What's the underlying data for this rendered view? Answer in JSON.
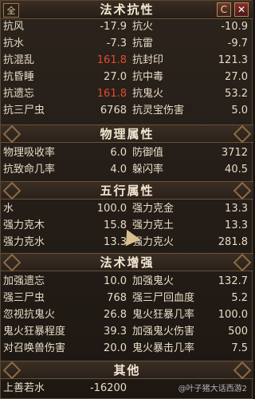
{
  "window": {
    "corner_label": "全",
    "title": "法术抗性",
    "refresh_label": "C",
    "close_label": "✕"
  },
  "sections": {
    "resist": [
      [
        "抗风",
        "-17.9",
        "抗火",
        "-10.9"
      ],
      [
        "抗水",
        "-7.3",
        "抗雷",
        "-9.7"
      ],
      [
        "抗混乱",
        "161.8",
        "抗封印",
        "121.3"
      ],
      [
        "抗昏睡",
        "27.0",
        "抗中毒",
        "27.0"
      ],
      [
        "抗遗忘",
        "161.8",
        "抗鬼火",
        "53.2"
      ],
      [
        "抗三尸虫",
        "6768",
        "抗灵宝伤害",
        "5.0"
      ]
    ],
    "physical_title": "物理属性",
    "physical": [
      [
        "物理吸收率",
        "6.0",
        "防御值",
        "3712"
      ],
      [
        "抗致命几率",
        "4.0",
        "躲闪率",
        "40.5"
      ]
    ],
    "five_title": "五行属性",
    "five": [
      [
        "水",
        "100.0",
        "强力克金",
        "13.3"
      ],
      [
        "强力克木",
        "15.8",
        "强力克土",
        "13.3"
      ],
      [
        "强力克水",
        "13.3",
        "强力克火",
        "281.8"
      ]
    ],
    "enhance_title": "法术增强",
    "enhance": [
      [
        "加强遗忘",
        "10.0",
        "加强鬼火",
        "132.7"
      ],
      [
        "强三尸虫",
        "768",
        "强三尸回血度",
        "5.2"
      ],
      [
        "忽视抗鬼火",
        "26.8",
        "鬼火狂暴几率",
        "100.0"
      ],
      [
        "鬼火狂暴程度",
        "39.3",
        "加强鬼火伤害",
        "500"
      ],
      [
        "对召唤兽伤害",
        "20.0",
        "鬼火暴击几率",
        "7.5"
      ]
    ],
    "other_title": "其他",
    "other": [
      [
        "上善若水",
        "-16200"
      ]
    ]
  },
  "watermark": "@叶子猪大话西游2",
  "colors": {
    "highlight": "#e24a2d"
  }
}
